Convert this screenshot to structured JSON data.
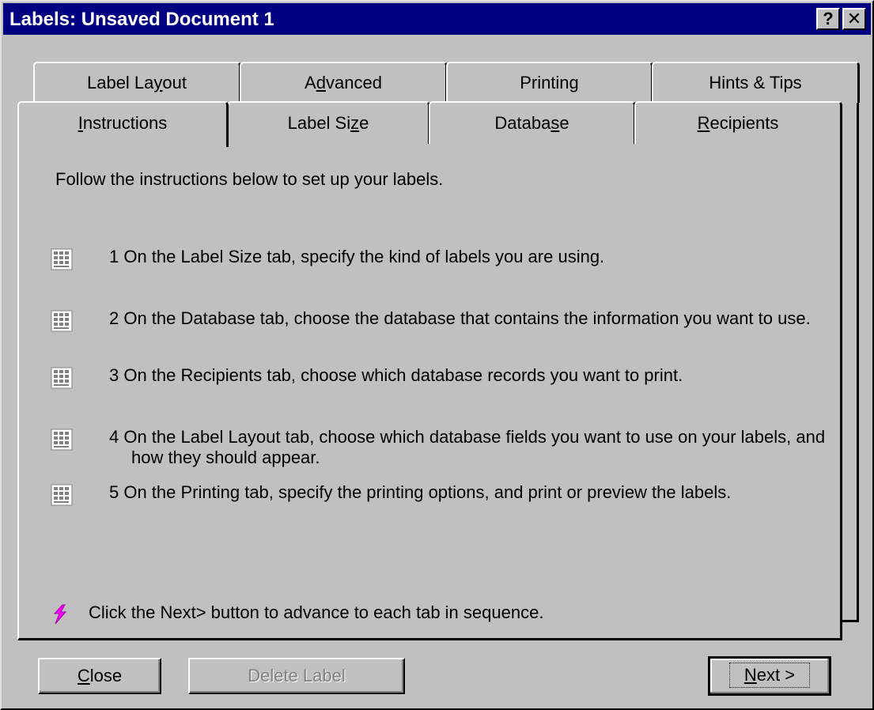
{
  "window": {
    "title": "Labels: Unsaved Document 1",
    "help_button": "?",
    "close_button": "✕"
  },
  "tabs": {
    "back_row": [
      {
        "pre": "Label La",
        "key": "y",
        "post": "out"
      },
      {
        "pre": "A",
        "key": "d",
        "post": "vanced"
      },
      {
        "pre": "Printin",
        "key": "g",
        "post": ""
      },
      {
        "pre": "Hints & Tips",
        "key": "",
        "post": ""
      }
    ],
    "front_row": [
      {
        "pre": "",
        "key": "I",
        "post": "nstructions"
      },
      {
        "pre": "Label Si",
        "key": "z",
        "post": "e"
      },
      {
        "pre": "Databa",
        "key": "s",
        "post": "e"
      },
      {
        "pre": "",
        "key": "R",
        "post": "ecipients"
      }
    ],
    "active": "Instructions"
  },
  "instructions": {
    "intro": "Follow the instructions below to set up your labels.",
    "steps": [
      "1  On the Label Size tab, specify the kind of labels you are using.",
      "2  On the Database tab, choose the database that contains the information you want to use.",
      "3  On the Recipients tab, choose which database records you want to print.",
      "4  On the Label Layout tab, choose which database fields you want to use on your labels, and how they should appear.",
      "5  On the Printing tab, specify the printing options, and print or preview the labels."
    ],
    "tip": "Click the Next> button to advance to each tab in sequence."
  },
  "buttons": {
    "close": {
      "key": "C",
      "post": "lose"
    },
    "delete_label": "Delete Label",
    "next": {
      "key": "N",
      "post": "ext >"
    }
  },
  "colors": {
    "titlebar": "#000080",
    "face": "#c0c0c0",
    "tip_icon": "#ff00ff"
  },
  "icons": {
    "step": "label-sheet-icon",
    "tip": "lightning-tip-icon"
  }
}
